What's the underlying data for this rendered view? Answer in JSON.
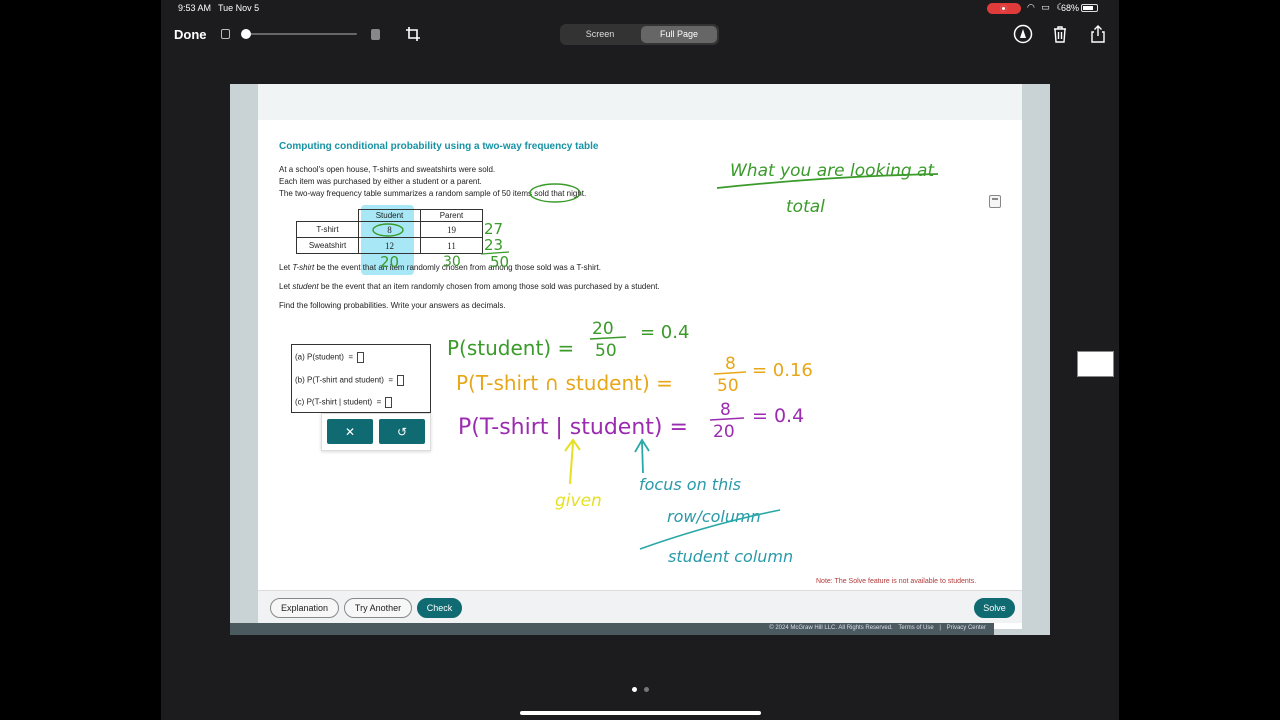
{
  "status_bar": {
    "time": "9:53 AM",
    "date": "Tue Nov 5",
    "battery": "68%"
  },
  "toolbar": {
    "done_label": "Done",
    "segments": [
      "Screen",
      "Full Page"
    ],
    "selected_segment": "Full Page"
  },
  "problem": {
    "title": "Computing conditional probability using a two-way frequency table",
    "intro_lines": [
      "At a school's open house, T-shirts and sweatshirts were sold.",
      "Each item was purchased by either a student or a parent.",
      "The two-way frequency table summarizes a random sample of 50 items sold that night."
    ],
    "table": {
      "columns": [
        "Student",
        "Parent"
      ],
      "rows": [
        {
          "label": "T-shirt",
          "values": [
            "8",
            "19"
          ]
        },
        {
          "label": "Sweatshirt",
          "values": [
            "12",
            "11"
          ]
        }
      ]
    },
    "event_tshirt": {
      "prefix": "Let ",
      "term": "T-shirt",
      "suffix": " be the event that an item randomly chosen from among those sold was a T-shirt."
    },
    "event_student": {
      "prefix": "Let ",
      "term": "student",
      "suffix": " be the event that an item randomly chosen from among those sold was purchased by a student."
    },
    "instruction": "Find the following probabilities. Write your answers as decimals.",
    "answers": [
      {
        "label": "(a)",
        "expr": "P(student)"
      },
      {
        "label": "(b)",
        "expr": "P(T-shirt and student)"
      },
      {
        "label": "(c)",
        "expr": "P(T-shirt | student)"
      }
    ],
    "equals": "="
  },
  "keypad": {
    "clear_symbol": "✕",
    "undo_symbol": "↺"
  },
  "note": "Note: The Solve feature is not available to students.",
  "buttons": {
    "explanation": "Explanation",
    "try_another": "Try Another",
    "check": "Check",
    "solve": "Solve"
  },
  "footer": {
    "copyright": "© 2024 McGraw Hill LLC. All Rights Reserved.",
    "terms": "Terms of Use",
    "separator": "|",
    "privacy": "Privacy Center"
  },
  "annotations": {
    "heading_line1": "What you are looking at",
    "heading_line2": "total",
    "margin_totals": [
      "27",
      "23",
      "50"
    ],
    "bottom_totals": [
      "20",
      "30"
    ],
    "eq1_lhs": "P(student) =",
    "eq1_num": "20",
    "eq1_den": "50",
    "eq1_rhs": "= 0.4",
    "eq2_lhs": "P(T-shirt ∩ student) =",
    "eq2_num": "8",
    "eq2_den": "50",
    "eq2_rhs": "= 0.16",
    "eq3_lhs": "P(T-shirt | student) =",
    "eq3_num": "8",
    "eq3_den": "20",
    "eq3_rhs": "= 0.4",
    "given": "given",
    "focus_line1": "focus on this",
    "focus_line2": "row/column",
    "student_column": "student column",
    "colors": {
      "green": "#3a9a2a",
      "orange": "#e8a619",
      "purple": "#9b2bb0",
      "yellow": "#e6e024"
    }
  }
}
